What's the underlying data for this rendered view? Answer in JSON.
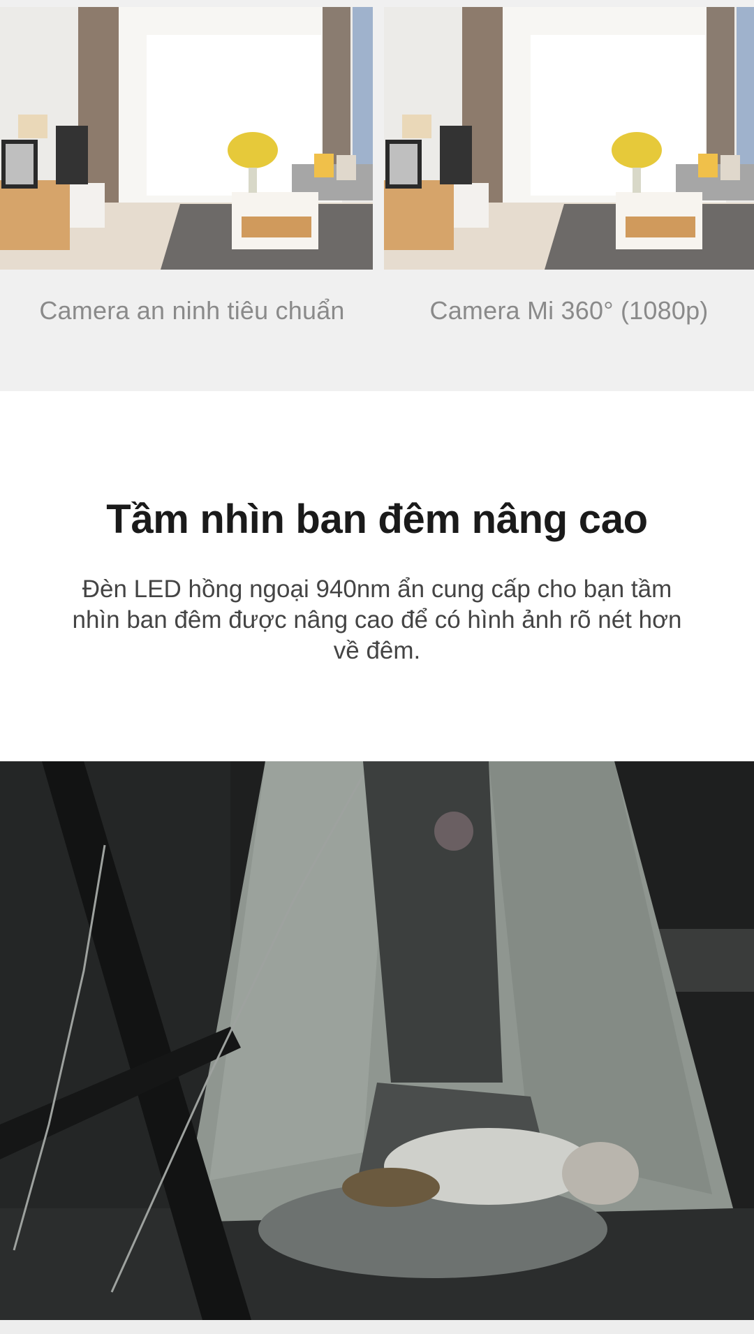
{
  "comparison": {
    "left_caption": "Camera an ninh tiêu chuẩn",
    "right_caption": "Camera Mi 360° (1080p)"
  },
  "feature": {
    "title": "Tầm nhìn ban đêm nâng cao",
    "description": "Đèn LED hồng ngoại 940nm ẩn cung cấp cho bạn tầm nhìn ban đêm được nâng cao để có hình ảnh rõ nét hơn về đêm."
  },
  "colors": {
    "section_bg": "#f0f0f0",
    "title_text": "#1a1a1a",
    "body_text": "#444444",
    "caption_text": "#8a8a8a"
  }
}
